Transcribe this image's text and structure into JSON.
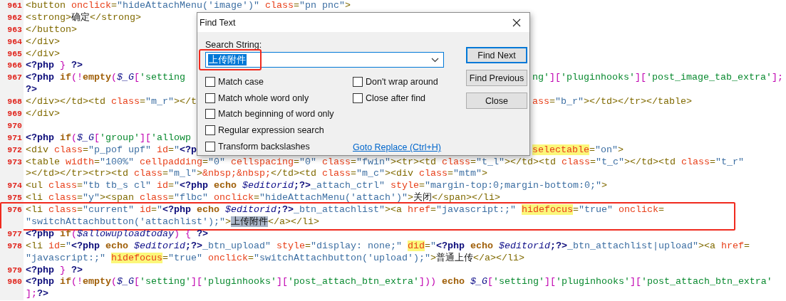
{
  "editor": {
    "lines": [
      {
        "number": "961",
        "rows": [
          {
            "tokens": [
              {
                "kind": "tag",
                "text": "<button "
              },
              {
                "kind": "attr",
                "text": "onclick"
              },
              {
                "kind": "tag",
                "text": "="
              },
              {
                "kind": "str",
                "text": "\"hideAttachMenu('image')\""
              },
              {
                "kind": "attr",
                "text": " class"
              },
              {
                "kind": "tag",
                "text": "="
              },
              {
                "kind": "str",
                "text": "\"pn pnc\""
              },
              {
                "kind": "tag",
                "text": ">"
              }
            ]
          }
        ]
      },
      {
        "number": "962",
        "rows": [
          {
            "tokens": [
              {
                "kind": "tag",
                "text": "<strong>"
              },
              {
                "kind": "plain",
                "text": "确定"
              },
              {
                "kind": "tag",
                "text": "</strong>"
              }
            ]
          }
        ]
      },
      {
        "number": "963",
        "rows": [
          {
            "tokens": [
              {
                "kind": "tag",
                "text": "</button>"
              }
            ]
          }
        ]
      },
      {
        "number": "964",
        "rows": [
          {
            "tokens": [
              {
                "kind": "tag",
                "text": "</div>"
              }
            ]
          }
        ]
      },
      {
        "number": "965",
        "rows": [
          {
            "tokens": [
              {
                "kind": "tag",
                "text": "</div>"
              }
            ]
          }
        ]
      },
      {
        "number": "966",
        "rows": [
          {
            "tokens": [
              {
                "kind": "php",
                "text": "<?php "
              },
              {
                "kind": "bracket",
                "text": "}"
              },
              {
                "kind": "php",
                "text": " ?>"
              }
            ]
          }
        ]
      },
      {
        "number": "967",
        "rows": [
          {
            "tokens": [
              {
                "kind": "php",
                "text": "<?php "
              },
              {
                "kind": "keyword",
                "text": "if"
              },
              {
                "kind": "bracket",
                "text": "(!"
              },
              {
                "kind": "keyword",
                "text": "empty"
              },
              {
                "kind": "bracket",
                "text": "("
              },
              {
                "kind": "var",
                "text": "$_G"
              },
              {
                "kind": "bracket",
                "text": "["
              },
              {
                "kind": "phpstr",
                "text": "'setting"
              }
            ],
            "tokens_right": [
              {
                "kind": "phpstr",
                "text": "ng'"
              },
              {
                "kind": "bracket",
                "text": "]["
              },
              {
                "kind": "phpstr",
                "text": "'pluginhooks'"
              },
              {
                "kind": "bracket",
                "text": "]["
              },
              {
                "kind": "phpstr",
                "text": "'post_image_tab_extra'"
              },
              {
                "kind": "bracket",
                "text": "];"
              }
            ]
          },
          {
            "tokens": [
              {
                "kind": "php",
                "text": "?>"
              }
            ]
          }
        ]
      },
      {
        "number": "968",
        "rows": [
          {
            "tokens": [
              {
                "kind": "tag",
                "text": "</div></td><td "
              },
              {
                "kind": "attr",
                "text": "class"
              },
              {
                "kind": "tag",
                "text": "="
              },
              {
                "kind": "str",
                "text": "\"m_r\""
              },
              {
                "kind": "tag",
                "text": "></t"
              }
            ],
            "tokens_right": [
              {
                "kind": "attr",
                "text": "ass"
              },
              {
                "kind": "tag",
                "text": "="
              },
              {
                "kind": "str",
                "text": "\"b_r\""
              },
              {
                "kind": "tag",
                "text": "></td></tr></table>"
              }
            ]
          }
        ]
      },
      {
        "number": "969",
        "rows": [
          {
            "tokens": [
              {
                "kind": "tag",
                "text": "</div>"
              }
            ]
          }
        ]
      },
      {
        "number": "970",
        "rows": [
          {
            "tokens": []
          }
        ]
      },
      {
        "number": "971",
        "rows": [
          {
            "tokens": [
              {
                "kind": "php",
                "text": "<?php "
              },
              {
                "kind": "keyword",
                "text": "if"
              },
              {
                "kind": "bracket",
                "text": "("
              },
              {
                "kind": "var",
                "text": "$_G"
              },
              {
                "kind": "bracket",
                "text": "["
              },
              {
                "kind": "phpstr",
                "text": "'group'"
              },
              {
                "kind": "bracket",
                "text": "]["
              },
              {
                "kind": "phpstr",
                "text": "'allowp"
              }
            ]
          }
        ]
      },
      {
        "number": "972",
        "rows": [
          {
            "tokens": [
              {
                "kind": "tag",
                "text": "<div "
              },
              {
                "kind": "attr",
                "text": "class"
              },
              {
                "kind": "tag",
                "text": "="
              },
              {
                "kind": "str",
                "text": "\"p_pof upf\""
              },
              {
                "kind": "attr",
                "text": " id"
              },
              {
                "kind": "tag",
                "text": "="
              },
              {
                "kind": "str",
                "text": "\""
              },
              {
                "kind": "php",
                "text": "<?p"
              }
            ],
            "tokens_right": [
              {
                "kind": "marked_attr",
                "text": "selectable"
              },
              {
                "kind": "tag",
                "text": "="
              },
              {
                "kind": "str",
                "text": "\"on\""
              },
              {
                "kind": "tag",
                "text": ">"
              }
            ]
          }
        ]
      },
      {
        "number": "973",
        "rows": [
          {
            "tokens": [
              {
                "kind": "tag",
                "text": "<table "
              },
              {
                "kind": "attr",
                "text": "width"
              },
              {
                "kind": "tag",
                "text": "="
              },
              {
                "kind": "str",
                "text": "\"100%\""
              },
              {
                "kind": "attr",
                "text": " cellpadding"
              },
              {
                "kind": "tag",
                "text": "="
              },
              {
                "kind": "str",
                "text": "\"0\""
              },
              {
                "kind": "attr",
                "text": " cellspacing"
              },
              {
                "kind": "tag",
                "text": "="
              },
              {
                "kind": "str",
                "text": "\"0\""
              },
              {
                "kind": "attr",
                "text": " class"
              },
              {
                "kind": "tag",
                "text": "="
              },
              {
                "kind": "str",
                "text": "\"fwin\""
              },
              {
                "kind": "tag",
                "text": "><tr><td "
              },
              {
                "kind": "attr",
                "text": "class"
              },
              {
                "kind": "tag",
                "text": "="
              },
              {
                "kind": "str",
                "text": "\"t_l\""
              },
              {
                "kind": "tag",
                "text": "></td><td "
              },
              {
                "kind": "attr",
                "text": "class"
              },
              {
                "kind": "tag",
                "text": "="
              },
              {
                "kind": "str",
                "text": "\"t_c\""
              },
              {
                "kind": "tag",
                "text": "></td><td "
              },
              {
                "kind": "attr",
                "text": "class"
              },
              {
                "kind": "tag",
                "text": "="
              },
              {
                "kind": "str",
                "text": "\"t_r\""
              }
            ]
          },
          {
            "tokens": [
              {
                "kind": "tag",
                "text": "></td></tr><tr><td "
              },
              {
                "kind": "attr",
                "text": "class"
              },
              {
                "kind": "tag",
                "text": "="
              },
              {
                "kind": "str",
                "text": "\"m_l\""
              },
              {
                "kind": "tag",
                "text": ">"
              },
              {
                "kind": "attr",
                "text": "&nbsp;&nbsp;"
              },
              {
                "kind": "tag",
                "text": "</td><td "
              },
              {
                "kind": "attr",
                "text": "class"
              },
              {
                "kind": "tag",
                "text": "="
              },
              {
                "kind": "str",
                "text": "\"m_c\""
              },
              {
                "kind": "tag",
                "text": "><div "
              },
              {
                "kind": "attr",
                "text": "class"
              },
              {
                "kind": "tag",
                "text": "="
              },
              {
                "kind": "str",
                "text": "\"mtm\""
              },
              {
                "kind": "tag",
                "text": ">"
              }
            ]
          }
        ]
      },
      {
        "number": "974",
        "rows": [
          {
            "tokens": [
              {
                "kind": "tag",
                "text": "<ul "
              },
              {
                "kind": "attr",
                "text": "class"
              },
              {
                "kind": "tag",
                "text": "="
              },
              {
                "kind": "str",
                "text": "\"tb tb_s cl\""
              },
              {
                "kind": "attr",
                "text": " id"
              },
              {
                "kind": "tag",
                "text": "="
              },
              {
                "kind": "str",
                "text": "\""
              },
              {
                "kind": "php",
                "text": "<?php "
              },
              {
                "kind": "keyword",
                "text": "echo "
              },
              {
                "kind": "var",
                "text": "$editorid"
              },
              {
                "kind": "php",
                "text": ";?>"
              },
              {
                "kind": "str",
                "text": "_attach_ctrl\""
              },
              {
                "kind": "attr",
                "text": " style"
              },
              {
                "kind": "tag",
                "text": "="
              },
              {
                "kind": "str",
                "text": "\"margin-top:0;margin-bottom:0;\""
              },
              {
                "kind": "tag",
                "text": ">"
              }
            ]
          }
        ]
      },
      {
        "number": "975",
        "rows": [
          {
            "tokens": [
              {
                "kind": "tag",
                "text": "<li "
              },
              {
                "kind": "attr",
                "text": "class"
              },
              {
                "kind": "tag",
                "text": "="
              },
              {
                "kind": "str",
                "text": "\"y\""
              },
              {
                "kind": "tag",
                "text": "><span "
              },
              {
                "kind": "attr",
                "text": "class"
              },
              {
                "kind": "tag",
                "text": "="
              },
              {
                "kind": "str",
                "text": "\"flbc\""
              },
              {
                "kind": "attr",
                "text": " onclick"
              },
              {
                "kind": "tag",
                "text": "="
              },
              {
                "kind": "str",
                "text": "\"hideAttachMenu('attach')\""
              },
              {
                "kind": "tag",
                "text": ">"
              },
              {
                "kind": "plain",
                "text": "关闭"
              },
              {
                "kind": "tag",
                "text": "</span></li>"
              }
            ]
          }
        ]
      },
      {
        "number": "976",
        "boxed": true,
        "rows": [
          {
            "tokens": [
              {
                "kind": "tag",
                "text": "<li "
              },
              {
                "kind": "attr",
                "text": "class"
              },
              {
                "kind": "tag",
                "text": "="
              },
              {
                "kind": "str",
                "text": "\"current\""
              },
              {
                "kind": "attr",
                "text": " id"
              },
              {
                "kind": "tag",
                "text": "="
              },
              {
                "kind": "str",
                "text": "\""
              },
              {
                "kind": "php",
                "text": "<?php "
              },
              {
                "kind": "keyword",
                "text": "echo "
              },
              {
                "kind": "var",
                "text": "$editorid"
              },
              {
                "kind": "php",
                "text": ";?>"
              },
              {
                "kind": "str",
                "text": "_btn_attachlist\""
              },
              {
                "kind": "tag",
                "text": "><a "
              },
              {
                "kind": "attr",
                "text": "href"
              },
              {
                "kind": "tag",
                "text": "="
              },
              {
                "kind": "str",
                "text": "\"javascript:;\" "
              },
              {
                "kind": "marked_attr",
                "text": "hidefocus"
              },
              {
                "kind": "tag",
                "text": "="
              },
              {
                "kind": "str",
                "text": "\"true\""
              },
              {
                "kind": "attr",
                "text": " onclick"
              },
              {
                "kind": "tag",
                "text": "="
              }
            ]
          },
          {
            "tokens": [
              {
                "kind": "str",
                "text": "\"switchAttachbutton('attachlist');\""
              },
              {
                "kind": "tag",
                "text": ">"
              },
              {
                "kind": "match",
                "text": "上传附件"
              },
              {
                "kind": "tag",
                "text": "</a></li>"
              }
            ]
          }
        ]
      },
      {
        "number": "977",
        "rows": [
          {
            "tokens": [
              {
                "kind": "php",
                "text": "<?php "
              },
              {
                "kind": "keyword",
                "text": "if"
              },
              {
                "kind": "bracket",
                "text": "("
              },
              {
                "kind": "var",
                "text": "$allowuploadtoday"
              },
              {
                "kind": "bracket",
                "text": ") { "
              },
              {
                "kind": "php",
                "text": "?>"
              }
            ]
          }
        ]
      },
      {
        "number": "978",
        "rows": [
          {
            "tokens": [
              {
                "kind": "tag",
                "text": "<li "
              },
              {
                "kind": "attr",
                "text": "id"
              },
              {
                "kind": "tag",
                "text": "="
              },
              {
                "kind": "str",
                "text": "\""
              },
              {
                "kind": "php",
                "text": "<?php "
              },
              {
                "kind": "keyword",
                "text": "echo "
              },
              {
                "kind": "var",
                "text": "$editorid"
              },
              {
                "kind": "php",
                "text": ";?>"
              },
              {
                "kind": "str",
                "text": "_btn_upload\""
              },
              {
                "kind": "attr",
                "text": " style"
              },
              {
                "kind": "tag",
                "text": "="
              },
              {
                "kind": "str",
                "text": "\"display: none;\" "
              },
              {
                "kind": "marked_attr",
                "text": "did"
              },
              {
                "kind": "tag",
                "text": "="
              },
              {
                "kind": "str",
                "text": "\""
              },
              {
                "kind": "php",
                "text": "<?php "
              },
              {
                "kind": "keyword",
                "text": "echo "
              },
              {
                "kind": "var",
                "text": "$editorid"
              },
              {
                "kind": "php",
                "text": ";?>"
              },
              {
                "kind": "str",
                "text": "_btn_attachlist|upload\""
              },
              {
                "kind": "tag",
                "text": "><a "
              },
              {
                "kind": "attr",
                "text": "href"
              },
              {
                "kind": "tag",
                "text": "="
              }
            ]
          },
          {
            "tokens": [
              {
                "kind": "str",
                "text": "\"javascript:;\" "
              },
              {
                "kind": "marked_attr",
                "text": "hidefocus"
              },
              {
                "kind": "tag",
                "text": "="
              },
              {
                "kind": "str",
                "text": "\"true\""
              },
              {
                "kind": "attr",
                "text": " onclick"
              },
              {
                "kind": "tag",
                "text": "="
              },
              {
                "kind": "str",
                "text": "\"switchAttachbutton('upload');\""
              },
              {
                "kind": "tag",
                "text": ">"
              },
              {
                "kind": "plain",
                "text": "普通上传"
              },
              {
                "kind": "tag",
                "text": "</a></li>"
              }
            ]
          }
        ]
      },
      {
        "number": "979",
        "rows": [
          {
            "tokens": [
              {
                "kind": "php",
                "text": "<?php "
              },
              {
                "kind": "bracket",
                "text": "}"
              },
              {
                "kind": "php",
                "text": " ?>"
              }
            ]
          }
        ]
      },
      {
        "number": "980",
        "rows": [
          {
            "tokens": [
              {
                "kind": "php",
                "text": "<?php "
              },
              {
                "kind": "keyword",
                "text": "if"
              },
              {
                "kind": "bracket",
                "text": "(!"
              },
              {
                "kind": "keyword",
                "text": "empty"
              },
              {
                "kind": "bracket",
                "text": "("
              },
              {
                "kind": "var",
                "text": "$_G"
              },
              {
                "kind": "bracket",
                "text": "["
              },
              {
                "kind": "phpstr",
                "text": "'setting'"
              },
              {
                "kind": "bracket",
                "text": "]["
              },
              {
                "kind": "phpstr",
                "text": "'pluginhooks'"
              },
              {
                "kind": "bracket",
                "text": "]["
              },
              {
                "kind": "phpstr",
                "text": "'post_attach_btn_extra'"
              },
              {
                "kind": "bracket",
                "text": "])) "
              },
              {
                "kind": "keyword",
                "text": "echo "
              },
              {
                "kind": "var",
                "text": "$_G"
              },
              {
                "kind": "bracket",
                "text": "["
              },
              {
                "kind": "phpstr",
                "text": "'setting'"
              },
              {
                "kind": "bracket",
                "text": "]["
              },
              {
                "kind": "phpstr",
                "text": "'pluginhooks'"
              },
              {
                "kind": "bracket",
                "text": "]["
              },
              {
                "kind": "phpstr",
                "text": "'post_attach_btn_extra'"
              }
            ]
          },
          {
            "tokens": [
              {
                "kind": "bracket",
                "text": "];"
              },
              {
                "kind": "php",
                "text": "?>"
              }
            ]
          }
        ]
      }
    ]
  },
  "find_dialog": {
    "title": "Find Text",
    "search_label": "Search String:",
    "search_field": {
      "value": "上传附件",
      "text_selected": true,
      "boxed": true
    },
    "options_left": [
      {
        "label": "Match case",
        "checked": false
      },
      {
        "label": "Match whole word only",
        "checked": false
      },
      {
        "label": "Match beginning of word only",
        "checked": false
      },
      {
        "label": "Regular expression search",
        "checked": false
      },
      {
        "label": "Transform backslashes",
        "checked": false
      }
    ],
    "options_right": [
      {
        "label": "Don't wrap around",
        "checked": false
      },
      {
        "label": "Close after find",
        "checked": false
      }
    ],
    "link": "Goto Replace (Ctrl+H)",
    "buttons": [
      {
        "label": "Find Next",
        "default": true
      },
      {
        "label": "Find Previous",
        "default": false
      },
      {
        "label": "Close",
        "default": false
      }
    ]
  }
}
